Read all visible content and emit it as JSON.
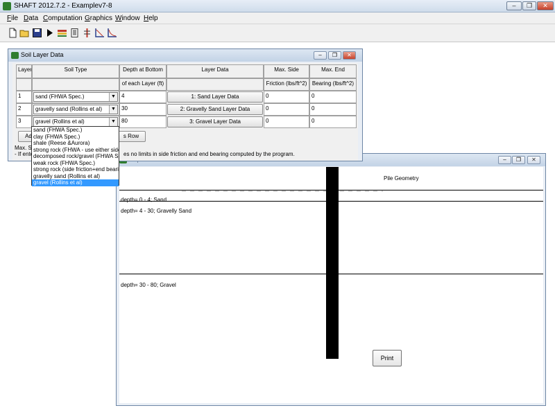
{
  "app": {
    "title": "SHAFT 2012.7.2 - Examplev7-8",
    "window_controls": {
      "minimize": "–",
      "restore": "❐",
      "close": "✕"
    }
  },
  "menu": [
    {
      "label": "File",
      "underline": "F"
    },
    {
      "label": "Data",
      "underline": "D"
    },
    {
      "label": "Computation",
      "underline": "C"
    },
    {
      "label": "Graphics",
      "underline": "G"
    },
    {
      "label": "Window",
      "underline": "W"
    },
    {
      "label": "Help",
      "underline": "H"
    }
  ],
  "toolbar": {
    "icons": [
      "new-file-icon",
      "open-folder-icon",
      "save-icon",
      "run-icon",
      "soil-layers-icon",
      "report-icon",
      "load-icon",
      "graph-icon",
      "curve-icon"
    ]
  },
  "soil_window": {
    "title": "Soil Layer Data",
    "headers": {
      "layer": "Layer",
      "soil_type": "Soil Type",
      "depth_1": "Depth at Bottom",
      "depth_2": "of each Layer (ft)",
      "layer_data": "Layer  Data",
      "side_1": "Max. Side",
      "side_2": "Friction (lbs/ft^2)",
      "end_1": "Max. End",
      "end_2": "Bearing (lbs/ft^2)"
    },
    "rows": [
      {
        "layer": "1",
        "soil_type": "sand (FHWA Spec.)",
        "depth": "4",
        "button": "1: Sand Layer Data",
        "side": "0",
        "end": "0"
      },
      {
        "layer": "2",
        "soil_type": "gravelly sand (Rollins et al)",
        "depth": "30",
        "button": "2: Gravelly Sand Layer Data",
        "side": "0",
        "end": "0"
      },
      {
        "layer": "3",
        "soil_type": "gravel (Rollins et al)",
        "depth": "80",
        "button": "3: Gravel Layer Data",
        "side": "0",
        "end": "0"
      }
    ],
    "add_button_partial": "Ad",
    "row_button_partial": "s Row",
    "note_left_1": "Max. S",
    "note_left_2": "- If ente",
    "note_right": "es no limits in side friction and end bearing computed by the program.",
    "dropdown_options": [
      "sand (FHWA Spec.)",
      "clay (FHWA Spec.)",
      "shale (Reese &Aurora)",
      "strong rock (FHWA - use either side",
      "decomposed rock/gravel (FHWA Sp",
      "weak rock (FHWA Spec.)",
      "strong rock (side friction+end bearing",
      "gravelly sand (Rollins et al)",
      "gravel (Rollins et al)"
    ],
    "dropdown_selected_index": 8
  },
  "depth_window": {
    "title_partial": "Depth Ge",
    "plot_title": "Pile Geometry",
    "layer_labels": [
      "depth= 0 - 4; Sand",
      "depth= 4 - 30; Gravelly Sand",
      "depth= 30 - 80; Gravel"
    ],
    "print_button": "Print"
  }
}
